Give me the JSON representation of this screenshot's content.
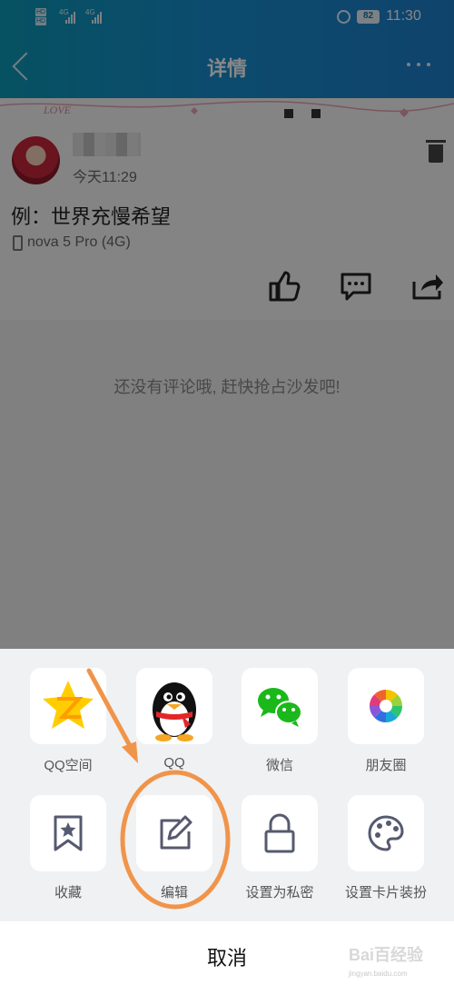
{
  "status_bar": {
    "hd_label": "HD",
    "network": "4G",
    "battery": "82",
    "time": "11:30"
  },
  "nav": {
    "title": "详情"
  },
  "decoration_text": "LOVE",
  "post": {
    "time": "今天11:29",
    "content": "例：世界充慢希望",
    "device": "nova 5 Pro (4G)"
  },
  "comments": {
    "empty_text": "还没有评论哦, 赶快抢占沙发吧!"
  },
  "share": {
    "row1": [
      {
        "label": "QQ空间",
        "icon": "qzone-icon"
      },
      {
        "label": "QQ",
        "icon": "qq-penguin-icon"
      },
      {
        "label": "微信",
        "icon": "wechat-icon"
      },
      {
        "label": "朋友圈",
        "icon": "moments-icon"
      }
    ],
    "row2": [
      {
        "label": "收藏",
        "icon": "bookmark-icon"
      },
      {
        "label": "编辑",
        "icon": "edit-icon"
      },
      {
        "label": "设置为私密",
        "icon": "lock-icon"
      },
      {
        "label": "设置卡片装扮",
        "icon": "palette-icon"
      }
    ],
    "cancel": "取消"
  },
  "watermark": {
    "text": "Bai百经验",
    "sub": "jingyan.baidu.com"
  },
  "colors": {
    "header_start": "#0d9ab9",
    "header_end": "#1e7fcd",
    "annotation": "#f0944a"
  }
}
